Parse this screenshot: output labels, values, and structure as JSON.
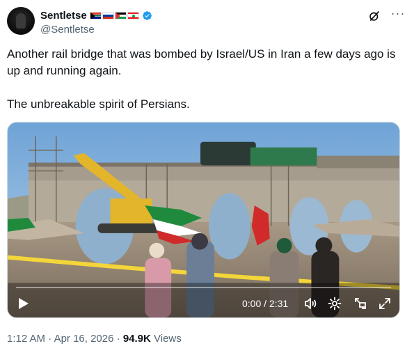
{
  "author": {
    "display_name": "Sentletse",
    "handle": "@Sentletse",
    "flags": [
      "south-africa-flag",
      "russia-flag",
      "palestine-flag",
      "lebanon-flag"
    ],
    "verified_color": "#1d9bf0"
  },
  "tweet": {
    "paragraphs": [
      "Another rail bridge that was bombed by Israel/US in Iran a few days ago is up and running again.",
      "The unbreakable spirit of Persians."
    ]
  },
  "video": {
    "current_time": "0:00",
    "duration": "2:31",
    "time_display": "0:00 / 2:31",
    "progress": 0,
    "controls": [
      "play-icon",
      "volume-icon",
      "settings-icon",
      "picture-in-picture-icon",
      "fullscreen-icon"
    ]
  },
  "meta": {
    "time": "1:12 AM",
    "separator1": " · ",
    "date": "Apr 16, 2026",
    "separator2": " · ",
    "views_count": "94.9K",
    "views_label": " Views"
  },
  "colors": {
    "secondary_text": "#536471",
    "primary_text": "#0f1419",
    "accent": "#1d9bf0"
  }
}
